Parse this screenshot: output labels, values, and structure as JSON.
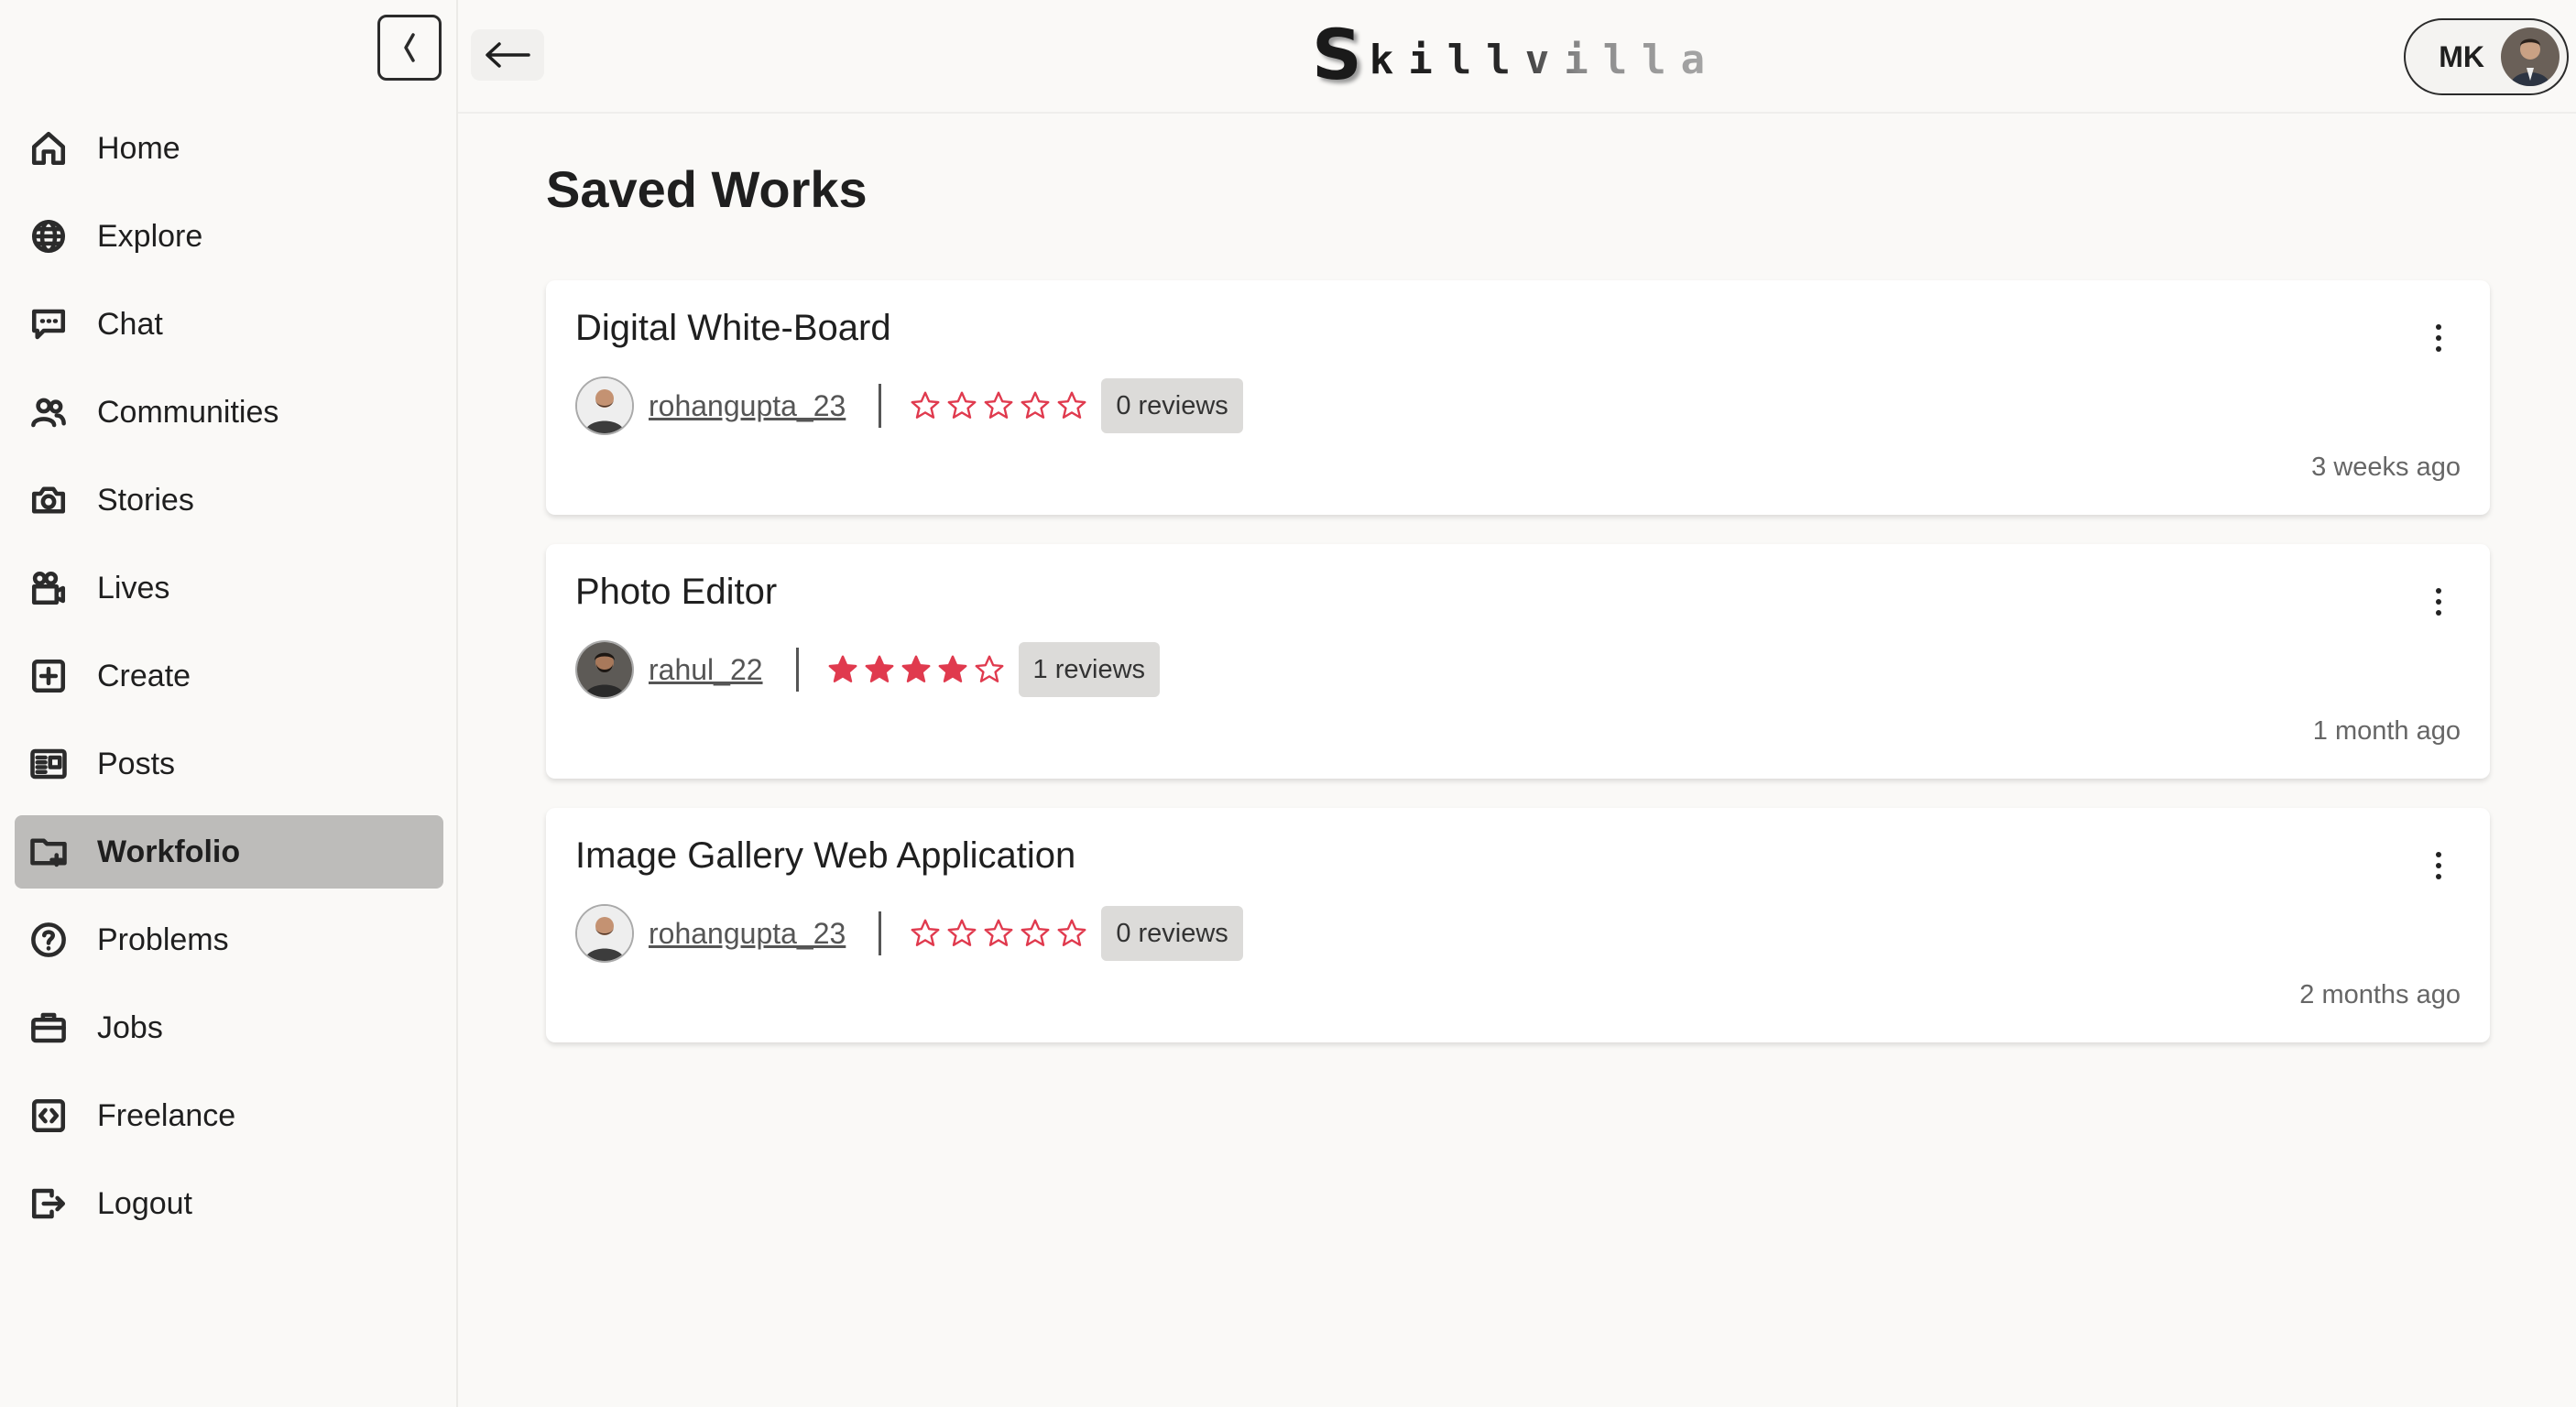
{
  "sidebar": {
    "items": [
      {
        "label": "Home",
        "icon": "home-icon"
      },
      {
        "label": "Explore",
        "icon": "globe-icon"
      },
      {
        "label": "Chat",
        "icon": "chat-icon"
      },
      {
        "label": "Communities",
        "icon": "users-icon"
      },
      {
        "label": "Stories",
        "icon": "camera-icon"
      },
      {
        "label": "Lives",
        "icon": "video-icon"
      },
      {
        "label": "Create",
        "icon": "plus-square-icon"
      },
      {
        "label": "Posts",
        "icon": "newspaper-icon"
      },
      {
        "label": "Workfolio",
        "icon": "folder-plus-icon",
        "active": true
      },
      {
        "label": "Problems",
        "icon": "question-circle-icon"
      },
      {
        "label": "Jobs",
        "icon": "briefcase-icon"
      },
      {
        "label": "Freelance",
        "icon": "code-icon"
      },
      {
        "label": "Logout",
        "icon": "logout-icon"
      }
    ]
  },
  "header": {
    "logo_first": "S",
    "logo_rest": "killvilla",
    "user_initials": "MK"
  },
  "main": {
    "title": "Saved Works",
    "cards": [
      {
        "title": "Digital White-Board",
        "author": "rohangupta_23",
        "rating": 0,
        "reviews": "0 reviews",
        "time": "3 weeks ago"
      },
      {
        "title": "Photo Editor",
        "author": "rahul_22",
        "rating": 4,
        "reviews": "1 reviews",
        "time": "1 month ago"
      },
      {
        "title": "Image Gallery Web Application",
        "author": "rohangupta_23",
        "rating": 0,
        "reviews": "0 reviews",
        "time": "2 months ago"
      }
    ]
  },
  "colors": {
    "star": "#e03a4e",
    "active_nav": "#bdbcba",
    "badge": "#dcdbd9"
  }
}
